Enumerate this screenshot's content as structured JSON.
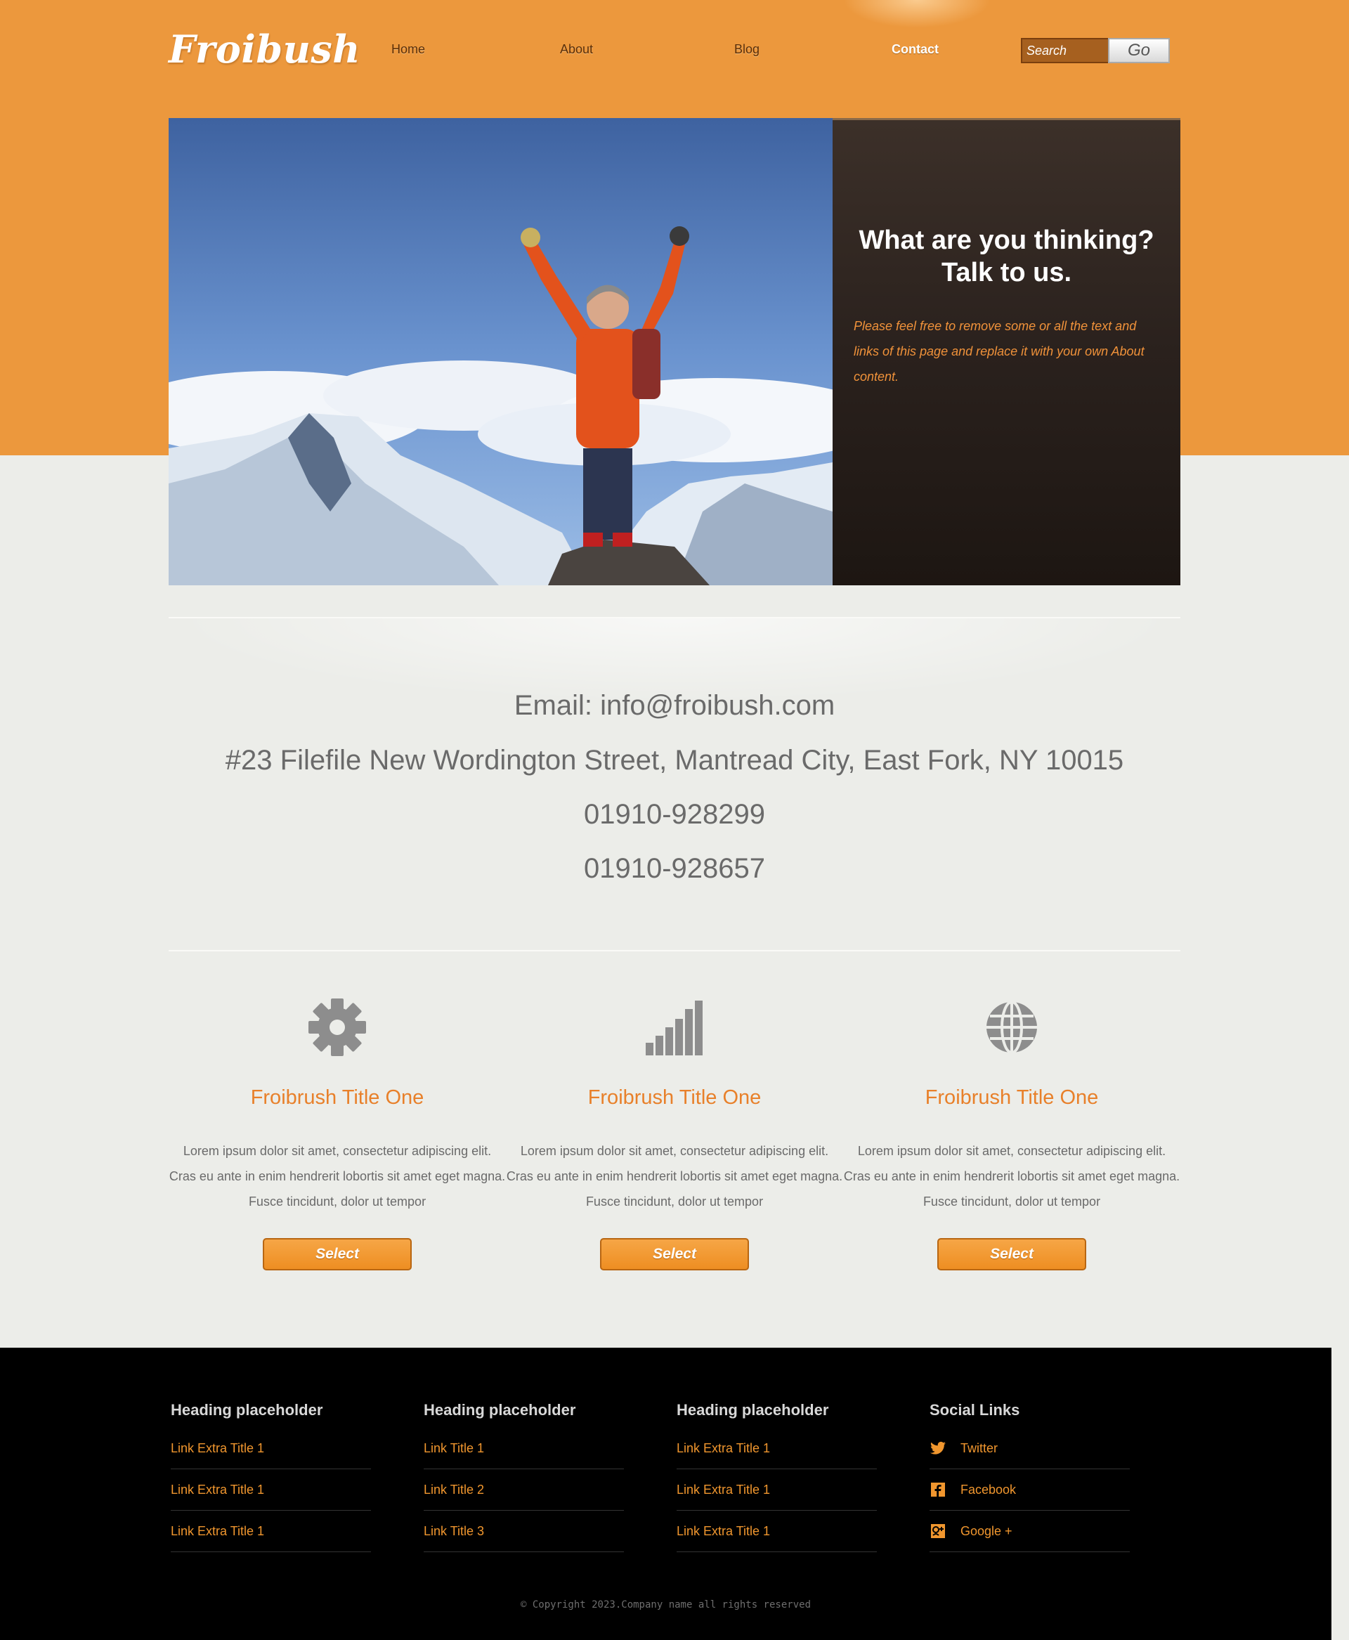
{
  "header": {
    "logo": "Froibush",
    "nav": [
      {
        "label": "Home"
      },
      {
        "label": "About"
      },
      {
        "label": "Blog"
      },
      {
        "label": "Contact",
        "active": true
      }
    ],
    "search_placeholder": "Search",
    "go_label": "Go"
  },
  "hero": {
    "title_line1": "What are you thinking?",
    "title_line2": "Talk to us.",
    "text": "Please feel free to remove some or all the text and links of this page and replace it with your own About content."
  },
  "contact": {
    "email": "Email: info@froibush.com",
    "address": "#23 Filefile New Wordington Street, Mantread City, East Fork, NY 10015",
    "phone1": "01910-928299",
    "phone2": "01910-928657"
  },
  "features": [
    {
      "icon": "gear-icon",
      "title": "Froibrush Title One",
      "text": "Lorem ipsum dolor sit amet, consectetur adipiscing elit. Cras eu ante in enim hendrerit lobortis sit amet eget magna. Fusce tincidunt, dolor ut tempor",
      "button": "Select"
    },
    {
      "icon": "signal-bars-icon",
      "title": "Froibrush Title One",
      "text": "Lorem ipsum dolor sit amet, consectetur adipiscing elit. Cras eu ante in enim hendrerit lobortis sit amet eget magna. Fusce tincidunt, dolor ut tempor",
      "button": "Select"
    },
    {
      "icon": "globe-icon",
      "title": "Froibrush Title One",
      "text": "Lorem ipsum dolor sit amet, consectetur adipiscing elit. Cras eu ante in enim hendrerit lobortis sit amet eget magna. Fusce tincidunt, dolor ut tempor",
      "button": "Select"
    }
  ],
  "footer": {
    "columns": [
      {
        "heading": "Heading placeholder",
        "links": [
          "Link Extra Title 1",
          "Link Extra Title 1",
          "Link Extra Title 1"
        ]
      },
      {
        "heading": "Heading placeholder",
        "links": [
          "Link Title 1",
          "Link Title 2",
          "Link Title 3"
        ]
      },
      {
        "heading": "Heading placeholder",
        "links": [
          "Link Extra Title 1",
          "Link Extra Title 1",
          "Link Extra Title 1"
        ]
      }
    ],
    "social": {
      "heading": "Social Links",
      "links": [
        {
          "label": "Twitter",
          "icon": "twitter-icon"
        },
        {
          "label": "Facebook",
          "icon": "facebook-icon"
        },
        {
          "label": "Google +",
          "icon": "google-plus-icon"
        }
      ]
    },
    "copyright": "© Copyright 2023.Company name all rights reserved"
  },
  "colors": {
    "brand_orange": "#ec983d",
    "accent_orange": "#e8802a",
    "footer_bg": "#000000",
    "page_bg": "#ecede9"
  }
}
